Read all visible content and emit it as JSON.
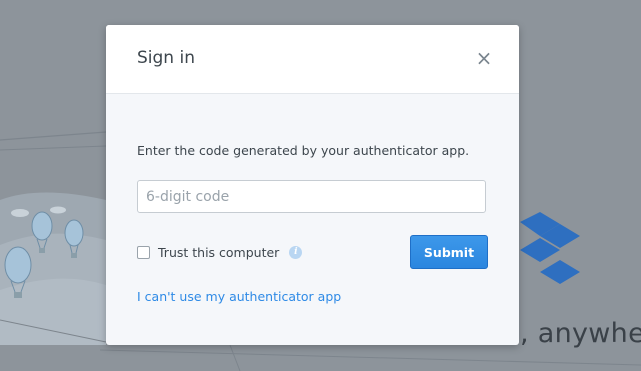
{
  "background": {
    "tagline": ", anywhe",
    "color": "#8d949b"
  },
  "modal": {
    "title": "Sign in",
    "close_symbol": "×",
    "instruction": "Enter the code generated by your authenticator app.",
    "code_input": {
      "placeholder": "6-digit code",
      "value": ""
    },
    "trust_label": "Trust this computer",
    "info_symbol": "i",
    "submit_label": "Submit",
    "alt_link": "I can't use my authenticator app"
  },
  "icons": {
    "close": "close-icon",
    "info": "info-icon",
    "logo": "dropbox-logo"
  },
  "colors": {
    "accent": "#2e8ae6",
    "button": "#2b86df",
    "text": "#3d464d"
  }
}
